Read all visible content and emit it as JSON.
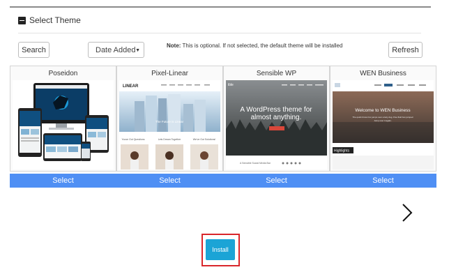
{
  "header": {
    "title": "Select Theme"
  },
  "toolbar": {
    "search_label": "Search",
    "sort_selected": "Date Added",
    "note_label": "Note:",
    "note_text": " This is optional. If not selected, the default theme will be installed",
    "refresh_label": "Refresh"
  },
  "themes": [
    {
      "name": "Poseidon",
      "select_label": "Select"
    },
    {
      "name": "Pixel-Linear",
      "select_label": "Select",
      "logo_text": "LINEAR",
      "hero_text": "The Future is Linear",
      "columns": [
        "Youve Got Questions",
        "Lets Dream Together",
        "We've Got Solutions!"
      ]
    },
    {
      "name": "Sensible WP",
      "select_label": "Select",
      "logo_text": "ible",
      "hero_text_line1": "A WordPress theme for",
      "hero_text_line2": "almost anything.",
      "footer_text": "A Sensible Social Media Bar"
    },
    {
      "name": "WEN Business",
      "select_label": "Select",
      "hero_title": "Welcome to WEN Business",
      "hero_sub1": "The quick brown fox jumps over a lazy dog. Five fluid box jumped",
      "hero_sub2": "Jump over it again.",
      "badge": "Highlights"
    }
  ],
  "install": {
    "label": "Install"
  },
  "colors": {
    "select_bar": "#4f8ff4",
    "install": "#1ba4d6",
    "highlight_outline": "#d9262b"
  }
}
